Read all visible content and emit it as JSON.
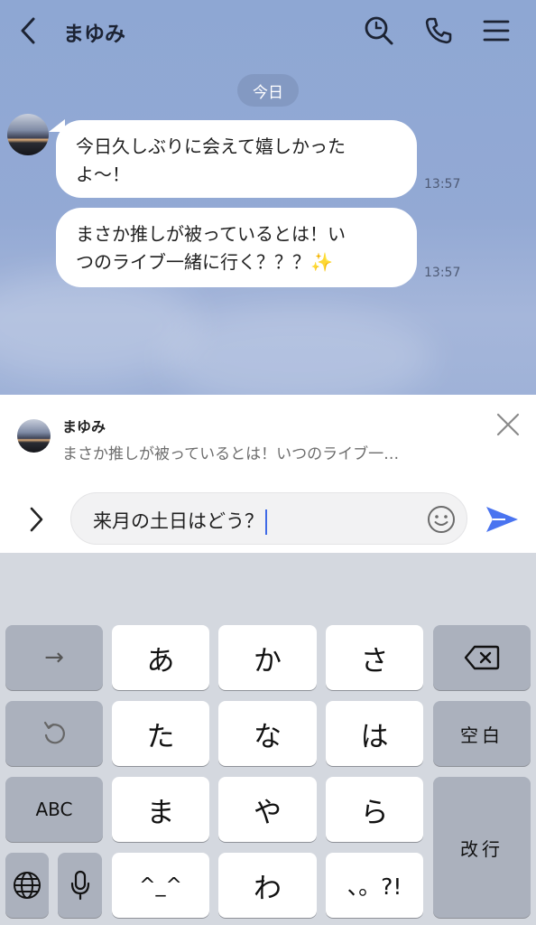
{
  "header": {
    "title": "まゆみ"
  },
  "date_separator": "今日",
  "messages": [
    {
      "line1": "今日久しぶりに会えて嬉しかった",
      "line2": "よ〜！",
      "time": "13:57"
    },
    {
      "line1": "まさか推しが被っているとは！い",
      "line2": "つのライブ一緒に行く？？？",
      "emoji": "✨",
      "time": "13:57"
    }
  ],
  "reply": {
    "name": "まゆみ",
    "text": "まさか推しが被っているとは！いつのライブ一…"
  },
  "composer": {
    "value": "来月の土日はどう？"
  },
  "keyboard": {
    "row1": [
      "→",
      "あ",
      "か",
      "さ"
    ],
    "row2": [
      "た",
      "な",
      "は",
      "空白"
    ],
    "row3": [
      "ABC",
      "ま",
      "や",
      "ら"
    ],
    "row4": [
      "^_^",
      "わ",
      "、。?!"
    ],
    "enter": "改行"
  },
  "colors": {
    "chat_bg": "#8ea7d3",
    "send": "#4a74f0",
    "caret": "#3f6ae6"
  }
}
